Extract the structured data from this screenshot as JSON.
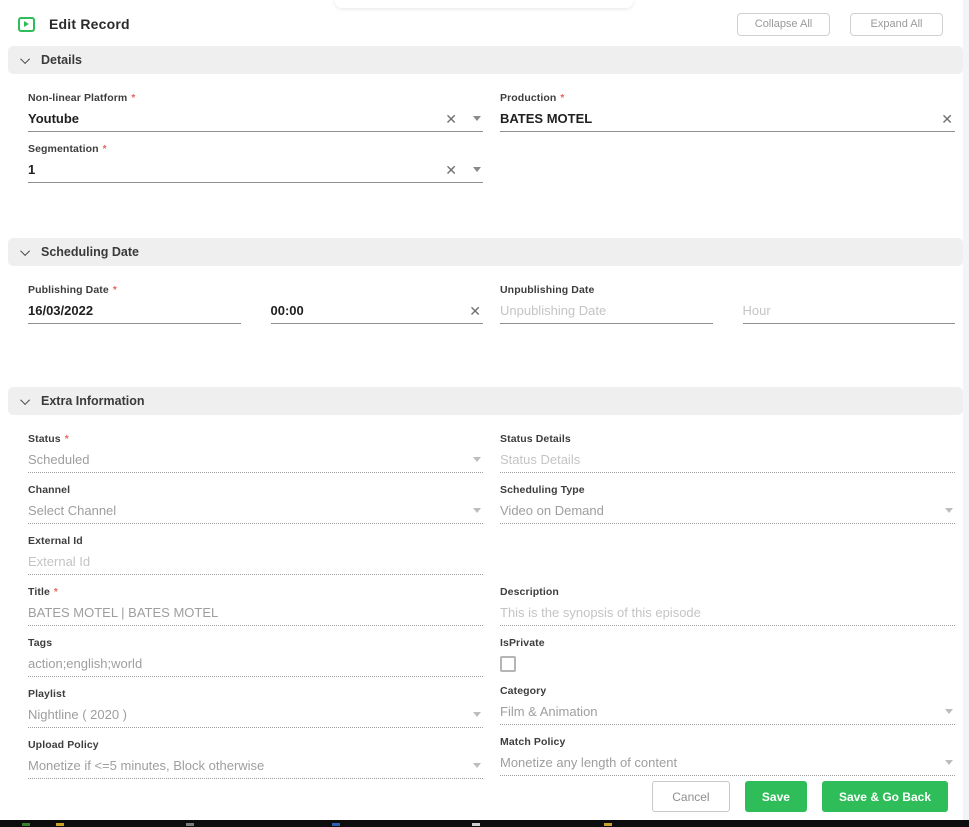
{
  "ui": {
    "required_marker": "*"
  },
  "header": {
    "title": "Edit Record",
    "collapse_all": "Collapse All",
    "expand_all": "Expand All"
  },
  "sections": {
    "details": "Details",
    "scheduling": "Scheduling Date",
    "extra": "Extra Information"
  },
  "details": {
    "platform": {
      "label": "Non-linear Platform",
      "value": "Youtube"
    },
    "production": {
      "label": "Production",
      "value": "BATES MOTEL"
    },
    "segmentation": {
      "label": "Segmentation",
      "value": "1"
    }
  },
  "scheduling": {
    "publishing": {
      "label": "Publishing Date",
      "date": "16/03/2022",
      "hour": "00:00"
    },
    "unpublishing": {
      "label": "Unpublishing Date",
      "date_placeholder": "Unpublishing Date",
      "hour_placeholder": "Hour"
    }
  },
  "extra": {
    "status": {
      "label": "Status",
      "value": "Scheduled"
    },
    "status_details": {
      "label": "Status Details",
      "placeholder": "Status Details"
    },
    "channel": {
      "label": "Channel",
      "placeholder": "Select Channel"
    },
    "scheduling_type": {
      "label": "Scheduling Type",
      "value": "Video on Demand"
    },
    "external_id": {
      "label": "External Id",
      "placeholder": "External Id"
    },
    "title": {
      "label": "Title",
      "value": "BATES MOTEL | BATES MOTEL"
    },
    "description": {
      "label": "Description",
      "placeholder": "This is the synopsis of this episode"
    },
    "tags": {
      "label": "Tags",
      "value": "action;english;world"
    },
    "is_private": {
      "label": "IsPrivate",
      "checked": false
    },
    "playlist": {
      "label": "Playlist",
      "value": "Nightline ( 2020 )"
    },
    "category": {
      "label": "Category",
      "value": "Film & Animation"
    },
    "upload_policy": {
      "label": "Upload Policy",
      "value": "Monetize if <=5 minutes, Block otherwise"
    },
    "match_policy": {
      "label": "Match Policy",
      "value": "Monetize any length of content"
    }
  },
  "footer": {
    "cancel": "Cancel",
    "save": "Save",
    "save_go_back": "Save & Go Back"
  },
  "colors": {
    "accent_green": "#2ebd59",
    "required_red": "#e8645e",
    "section_bg": "#efefef"
  }
}
